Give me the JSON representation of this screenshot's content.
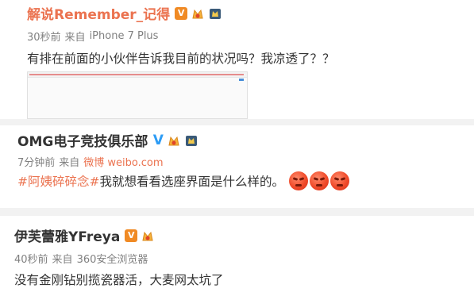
{
  "posts": [
    {
      "username": "解说Remember_记得",
      "verified_badge": "V",
      "meta_time": "30秒前",
      "meta_from": "来自",
      "meta_source": "iPhone 7 Plus",
      "text": "有排在前面的小伙伴告诉我目前的状况吗？我凉透了？？"
    },
    {
      "username": "OMG电子竞技俱乐部",
      "verified_badge": "V",
      "meta_time": "7分钟前",
      "meta_from": "来自",
      "meta_source": "微博 weibo.com",
      "hashtag": "#阿姨碎碎念#",
      "text": " 我就想看看选座界面是什么样的。"
    },
    {
      "username": "伊芙蕾雅YFreya",
      "verified_badge": "V",
      "meta_time": "40秒前",
      "meta_from": "来自",
      "meta_source": "360安全浏览器",
      "text": "没有金刚钻别揽瓷器活，大麦网太坑了"
    }
  ],
  "colors": {
    "accent": "#eb7350",
    "verified_orange": "#f08a24",
    "verified_blue": "#2d9cf5",
    "meta": "#808080"
  },
  "icons": [
    "vip-medal-icon",
    "level-crown-icon",
    "angry-emoji-icon"
  ]
}
